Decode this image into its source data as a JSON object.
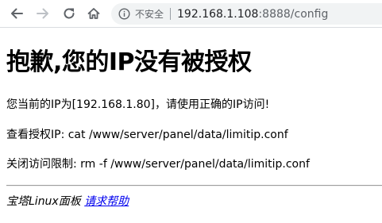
{
  "browser": {
    "security_label": "不安全",
    "url_host": "192.168.1.108",
    "url_path": ":8888/config",
    "icons": {
      "back": "back-arrow-icon",
      "forward": "forward-arrow-icon",
      "reload": "reload-icon",
      "home": "home-icon",
      "info": "info-icon"
    }
  },
  "page": {
    "title": "抱歉,您的IP没有被授权",
    "ip_message": "您当前的IP为[192.168.1.80]，请使用正确的IP访问!",
    "view_auth": "查看授权IP: cat /www/server/panel/data/limitip.conf",
    "close_limit": "关闭访问限制: rm -f /www/server/panel/data/limitip.conf",
    "footer_brand": "宝塔Linux面板",
    "footer_link": "请求帮助"
  },
  "colors": {
    "link": "#0000ee",
    "omnibox_bg": "#f1f3f4"
  }
}
